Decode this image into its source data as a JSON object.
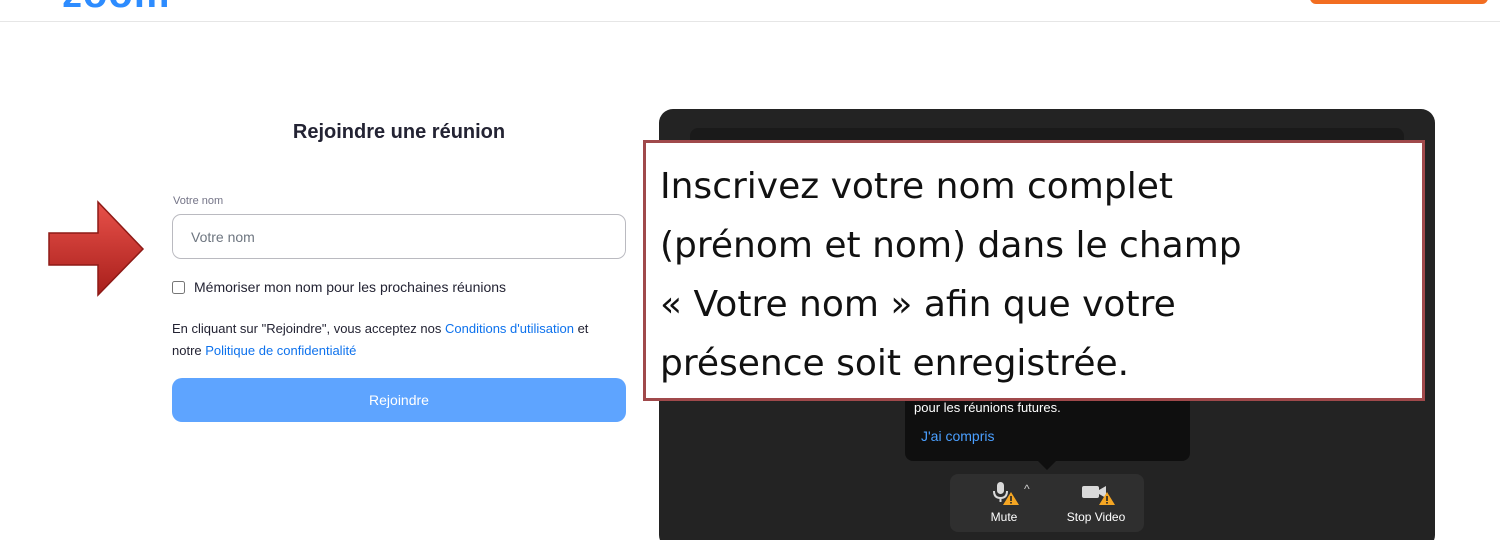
{
  "app": {
    "logo_text": "zoom"
  },
  "join_form": {
    "title": "Rejoindre une réunion",
    "name_label": "Votre nom",
    "name_placeholder": "Votre nom",
    "name_value": "",
    "remember_label": "Mémoriser mon nom pour les prochaines réunions",
    "remember_checked": false,
    "terms_prefix": "En cliquant sur \"Rejoindre\", vous acceptez nos ",
    "terms_link": "Conditions d'utilisation",
    "terms_middle": " et notre ",
    "privacy_link": "Politique de confidentialité",
    "join_button_label": "Rejoindre"
  },
  "preview": {
    "tooltip_text": "pour les réunions futures.",
    "tooltip_link": "J'ai compris",
    "mute_label": "Mute",
    "stop_video_label": "Stop Video",
    "caret": "^"
  },
  "annotation": {
    "text": "Inscrivez votre nom complet\n(prénom et nom) dans le champ\n« Votre nom » afin que votre\nprésence soit enregistrée."
  },
  "colors": {
    "brand_blue": "#2d8cff",
    "join_button": "#5ea4ff",
    "top_button_orange": "#f26d21",
    "arrow_red": "#c8302b",
    "callout_border": "#a0494b",
    "warning_yellow": "#f5a623"
  },
  "icons": {
    "arrow": "red-arrow-right-icon",
    "mute": "microphone-warning-icon",
    "video": "camera-warning-icon"
  }
}
